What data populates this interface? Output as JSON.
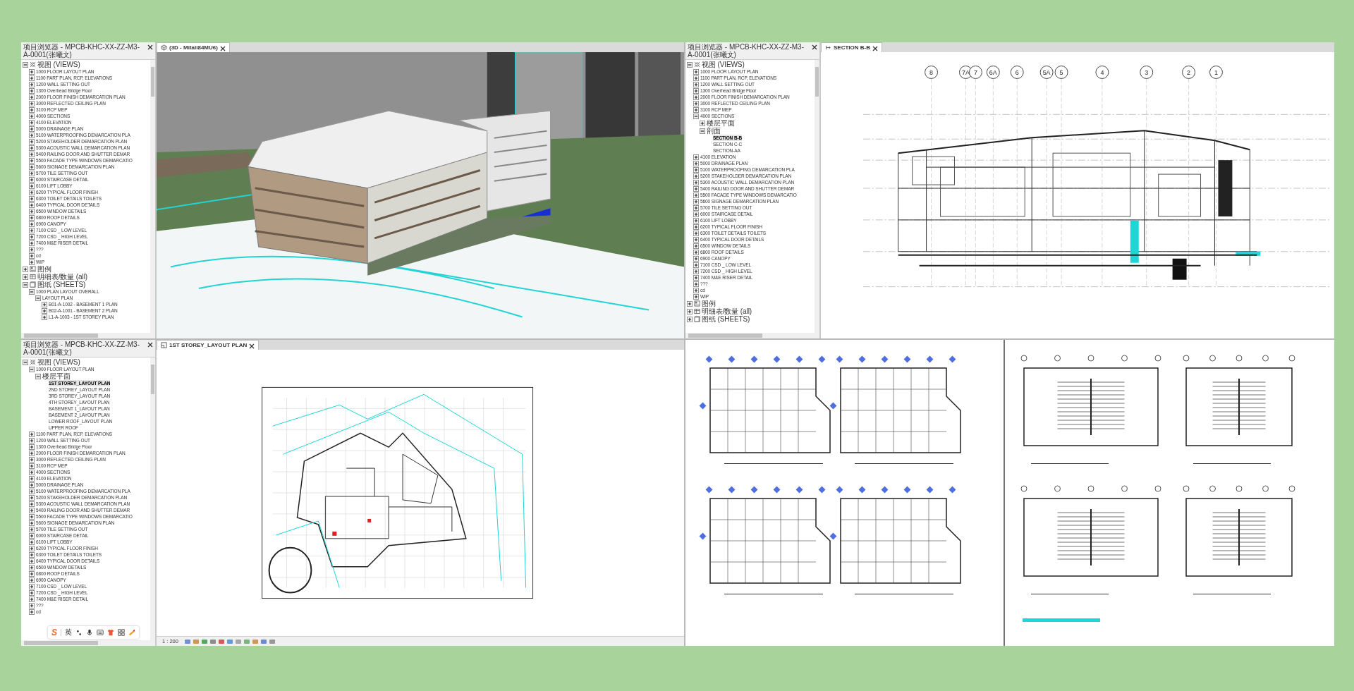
{
  "windows": [
    {
      "browser": {
        "title": "项目浏览器 - MPCB-KHC-XX-ZZ-M3-A-0001(张曦文)",
        "tree": [
          {
            "label": "视图 (VIEWS)",
            "kind": "views",
            "expanded": true,
            "children": [
              {
                "label": "1000 FLOOR LAYOUT PLAN",
                "expanded": false
              },
              {
                "label": "1100 PART PLAN, RCP, ELEVATIONS",
                "expanded": false
              },
              {
                "label": "1200 WALL SETTING OUT",
                "expanded": false
              },
              {
                "label": "1300 Overhead Bridge Floor",
                "expanded": false
              },
              {
                "label": "2000 FLOOR FINISH DEMARCATION PLAN",
                "expanded": false
              },
              {
                "label": "3000 REFLECTED CEILING PLAN",
                "expanded": false
              },
              {
                "label": "3100 RCP MEP",
                "expanded": false
              },
              {
                "label": "4000 SECTIONS",
                "expanded": false
              },
              {
                "label": "4100 ELEVATION",
                "expanded": false
              },
              {
                "label": "5000 DRAINAGE PLAN",
                "expanded": false
              },
              {
                "label": "5100 WATERPROOFING DEMARCATION PLA",
                "expanded": false
              },
              {
                "label": "5200 STAKEHOLDER DEMARCATION PLAN",
                "expanded": false
              },
              {
                "label": "5300 ACOUSTIC WALL DEMARCATION PLAN",
                "expanded": false
              },
              {
                "label": "5400 RAILING DOOR AND SHUTTER DEMAR",
                "expanded": false
              },
              {
                "label": "5500 FACADE TYPE WINDOWS DEMARCATIO",
                "expanded": false
              },
              {
                "label": "5600 SIGNAGE DEMARCATION PLAN",
                "expanded": false
              },
              {
                "label": "5700 TILE SETTING OUT",
                "expanded": false
              },
              {
                "label": "6000 STAIRCASE DETAIL",
                "expanded": false
              },
              {
                "label": "6100 LIFT LOBBY",
                "expanded": false
              },
              {
                "label": "6200 TYPICAL FLOOR FINISH",
                "expanded": false
              },
              {
                "label": "6300 TOILET DETAILS TOILETS",
                "expanded": false
              },
              {
                "label": "6400 TYPICAL DOOR DETAILS",
                "expanded": false
              },
              {
                "label": "6500 WINDOW DETAILS",
                "expanded": false
              },
              {
                "label": "6800 ROOF DETAILS",
                "expanded": false
              },
              {
                "label": "6900 CANOPY",
                "expanded": false
              },
              {
                "label": "7100 CSD _ LOW LEVEL",
                "expanded": false
              },
              {
                "label": "7200 CSD _ HIGH LEVEL",
                "expanded": false
              },
              {
                "label": "7400 M&E RISER DETAIL",
                "expanded": false
              },
              {
                "label": "???",
                "expanded": false
              },
              {
                "label": "cd",
                "expanded": false
              },
              {
                "label": "WIP",
                "expanded": false
              }
            ]
          },
          {
            "label": "图例",
            "kind": "legends",
            "expanded": false
          },
          {
            "label": "明细表/数量 (all)",
            "kind": "schedules",
            "expanded": false
          },
          {
            "label": "图纸 (SHEETS)",
            "kind": "sheets",
            "expanded": true,
            "children": [
              {
                "label": "1000 PLAN LAYOUT OVERALL",
                "expanded": true,
                "children": [
                  {
                    "label": "LAYOUT PLAN",
                    "expanded": true,
                    "children": [
                      {
                        "label": "B01-A-1002 - BASEMENT 1 PLAN",
                        "expanded": false
                      },
                      {
                        "label": "B02-A-1001 - BASEMENT 2 PLAN",
                        "expanded": false
                      },
                      {
                        "label": "L1-A-1003 - 1ST STOREY PLAN",
                        "expanded": false
                      }
                    ]
                  }
                ]
              }
            ]
          }
        ]
      },
      "view": {
        "kind": "model",
        "tab": "(3D - Mitali84MU6)"
      }
    },
    {
      "browser": {
        "title": "项目浏览器 - MPCB-KHC-XX-ZZ-M3-A-0001(张曦文)",
        "tree": [
          {
            "label": "视图 (VIEWS)",
            "kind": "views",
            "expanded": true,
            "children": [
              {
                "label": "1000 FLOOR LAYOUT PLAN",
                "expanded": false
              },
              {
                "label": "1100 PART PLAN, RCP, ELEVATIONS",
                "expanded": false
              },
              {
                "label": "1200 WALL SETTING OUT",
                "expanded": false
              },
              {
                "label": "1300 Overhead Bridge Floor",
                "expanded": false
              },
              {
                "label": "2000 FLOOR FINISH DEMARCATION PLAN",
                "expanded": false
              },
              {
                "label": "3000 REFLECTED CEILING PLAN",
                "expanded": false
              },
              {
                "label": "3100 RCP MEP",
                "expanded": false
              },
              {
                "label": "4000 SECTIONS",
                "expanded": true,
                "children": [
                  {
                    "label": "楼层平面",
                    "expanded": false
                  },
                  {
                    "label": "剖面",
                    "expanded": true,
                    "children": [
                      {
                        "label": "SECTION B-B",
                        "selected": true
                      },
                      {
                        "label": "SECTION C-C",
                        "selected": false
                      },
                      {
                        "label": "SECTION-AA",
                        "selected": false
                      }
                    ]
                  }
                ]
              },
              {
                "label": "4100 ELEVATION",
                "expanded": false
              },
              {
                "label": "5000 DRAINAGE PLAN",
                "expanded": false
              },
              {
                "label": "5100 WATERPROOFING DEMARCATION PLA",
                "expanded": false
              },
              {
                "label": "5200 STAKEHOLDER DEMARCATION PLAN",
                "expanded": false
              },
              {
                "label": "5300 ACOUSTIC WALL DEMARCATION PLAN",
                "expanded": false
              },
              {
                "label": "5400 RAILING DOOR AND SHUTTER DEMAR",
                "expanded": false
              },
              {
                "label": "5500 FACADE TYPE WINDOWS DEMARCATIO",
                "expanded": false
              },
              {
                "label": "5600 SIGNAGE DEMARCATION PLAN",
                "expanded": false
              },
              {
                "label": "5700 TILE SETTING OUT",
                "expanded": false
              },
              {
                "label": "6000 STAIRCASE DETAIL",
                "expanded": false
              },
              {
                "label": "6100 LIFT LOBBY",
                "expanded": false
              },
              {
                "label": "6200 TYPICAL FLOOR FINISH",
                "expanded": false
              },
              {
                "label": "6300 TOILET DETAILS TOILETS",
                "expanded": false
              },
              {
                "label": "6400 TYPICAL DOOR DETAILS",
                "expanded": false
              },
              {
                "label": "6500 WINDOW DETAILS",
                "expanded": false
              },
              {
                "label": "6800 ROOF DETAILS",
                "expanded": false
              },
              {
                "label": "6900 CANOPY",
                "expanded": false
              },
              {
                "label": "7100 CSD _ LOW LEVEL",
                "expanded": false
              },
              {
                "label": "7200 CSD _ HIGH LEVEL",
                "expanded": false
              },
              {
                "label": "7400 M&E RISER DETAIL",
                "expanded": false
              },
              {
                "label": "???",
                "expanded": false
              },
              {
                "label": "cd",
                "expanded": false
              },
              {
                "label": "WIP",
                "expanded": false
              }
            ]
          },
          {
            "label": "图例",
            "kind": "legends",
            "expanded": false
          },
          {
            "label": "明细表/数量 (all)",
            "kind": "schedules",
            "expanded": false
          },
          {
            "label": "图纸 (SHEETS)",
            "kind": "sheets",
            "expanded": false
          }
        ]
      },
      "view": {
        "kind": "section",
        "tab": "SECTION B-B",
        "grid_labels": [
          "8",
          "7A",
          "7",
          "6A",
          "6",
          "5A",
          "5",
          "4",
          "3",
          "2",
          "1"
        ]
      }
    },
    {
      "browser": {
        "title": "项目浏览器 - MPCB-KHC-XX-ZZ-M3-A-0001(张曦文)",
        "tree": [
          {
            "label": "视图 (VIEWS)",
            "kind": "views",
            "expanded": true,
            "children": [
              {
                "label": "1000 FLOOR LAYOUT PLAN",
                "expanded": true,
                "children": [
                  {
                    "label": "楼层平面",
                    "expanded": true,
                    "children": [
                      {
                        "label": "1ST STOREY_LAYOUT PLAN",
                        "selected": true
                      },
                      {
                        "label": "2ND STOREY_LAYOUT PLAN",
                        "selected": false
                      },
                      {
                        "label": "3RD STOREY_LAYOUT PLAN",
                        "selected": false
                      },
                      {
                        "label": "4TH STOREY_LAYOUT PLAN",
                        "selected": false
                      },
                      {
                        "label": "BASEMENT 1_LAYOUT PLAN",
                        "selected": false
                      },
                      {
                        "label": "BASEMENT 2_LAYOUT PLAN",
                        "selected": false
                      },
                      {
                        "label": "LOWER ROOF_LAYOUT PLAN",
                        "selected": false
                      },
                      {
                        "label": "UPPER ROOF",
                        "selected": false
                      }
                    ]
                  }
                ]
              },
              {
                "label": "1100 PART PLAN, RCP, ELEVATIONS",
                "expanded": false
              },
              {
                "label": "1200 WALL SETTING OUT",
                "expanded": false
              },
              {
                "label": "1300 Overhead Bridge Floor",
                "expanded": false
              },
              {
                "label": "2000 FLOOR FINISH DEMARCATION PLAN",
                "expanded": false
              },
              {
                "label": "3000 REFLECTED CEILING PLAN",
                "expanded": false
              },
              {
                "label": "3100 RCP MEP",
                "expanded": false
              },
              {
                "label": "4000 SECTIONS",
                "expanded": false
              },
              {
                "label": "4100 ELEVATION",
                "expanded": false
              },
              {
                "label": "5000 DRAINAGE PLAN",
                "expanded": false
              },
              {
                "label": "5100 WATERPROOFING DEMARCATION PLA",
                "expanded": false
              },
              {
                "label": "5200 STAKEHOLDER DEMARCATION PLAN",
                "expanded": false
              },
              {
                "label": "5300 ACOUSTIC WALL DEMARCATION PLAN",
                "expanded": false
              },
              {
                "label": "5400 RAILING DOOR AND SHUTTER DEMAR",
                "expanded": false
              },
              {
                "label": "5500 FACADE TYPE WINDOWS DEMARCATIO",
                "expanded": false
              },
              {
                "label": "5600 SIGNAGE DEMARCATION PLAN",
                "expanded": false
              },
              {
                "label": "5700 TILE SETTING OUT",
                "expanded": false
              },
              {
                "label": "6000 STAIRCASE DETAIL",
                "expanded": false
              },
              {
                "label": "6100 LIFT LOBBY",
                "expanded": false
              },
              {
                "label": "6200 TYPICAL FLOOR FINISH",
                "expanded": false
              },
              {
                "label": "6300 TOILET DETAILS TOILETS",
                "expanded": false
              },
              {
                "label": "6400 TYPICAL DOOR DETAILS",
                "expanded": false
              },
              {
                "label": "6500 WINDOW DETAILS",
                "expanded": false
              },
              {
                "label": "6800 ROOF DETAILS",
                "expanded": false
              },
              {
                "label": "6900 CANOPY",
                "expanded": false
              },
              {
                "label": "7100 CSD _ LOW LEVEL",
                "expanded": false
              },
              {
                "label": "7200 CSD _ HIGH LEVEL",
                "expanded": false
              },
              {
                "label": "7400 M&E RISER DETAIL",
                "expanded": false
              },
              {
                "label": "???",
                "expanded": false
              },
              {
                "label": "cd",
                "expanded": false
              }
            ]
          }
        ]
      },
      "view": {
        "kind": "plan",
        "tab": "1ST STOREY_LAYOUT PLAN",
        "scale": "1 : 200"
      },
      "ime_toolbar": {
        "logo": "S",
        "language": "英"
      }
    }
  ]
}
